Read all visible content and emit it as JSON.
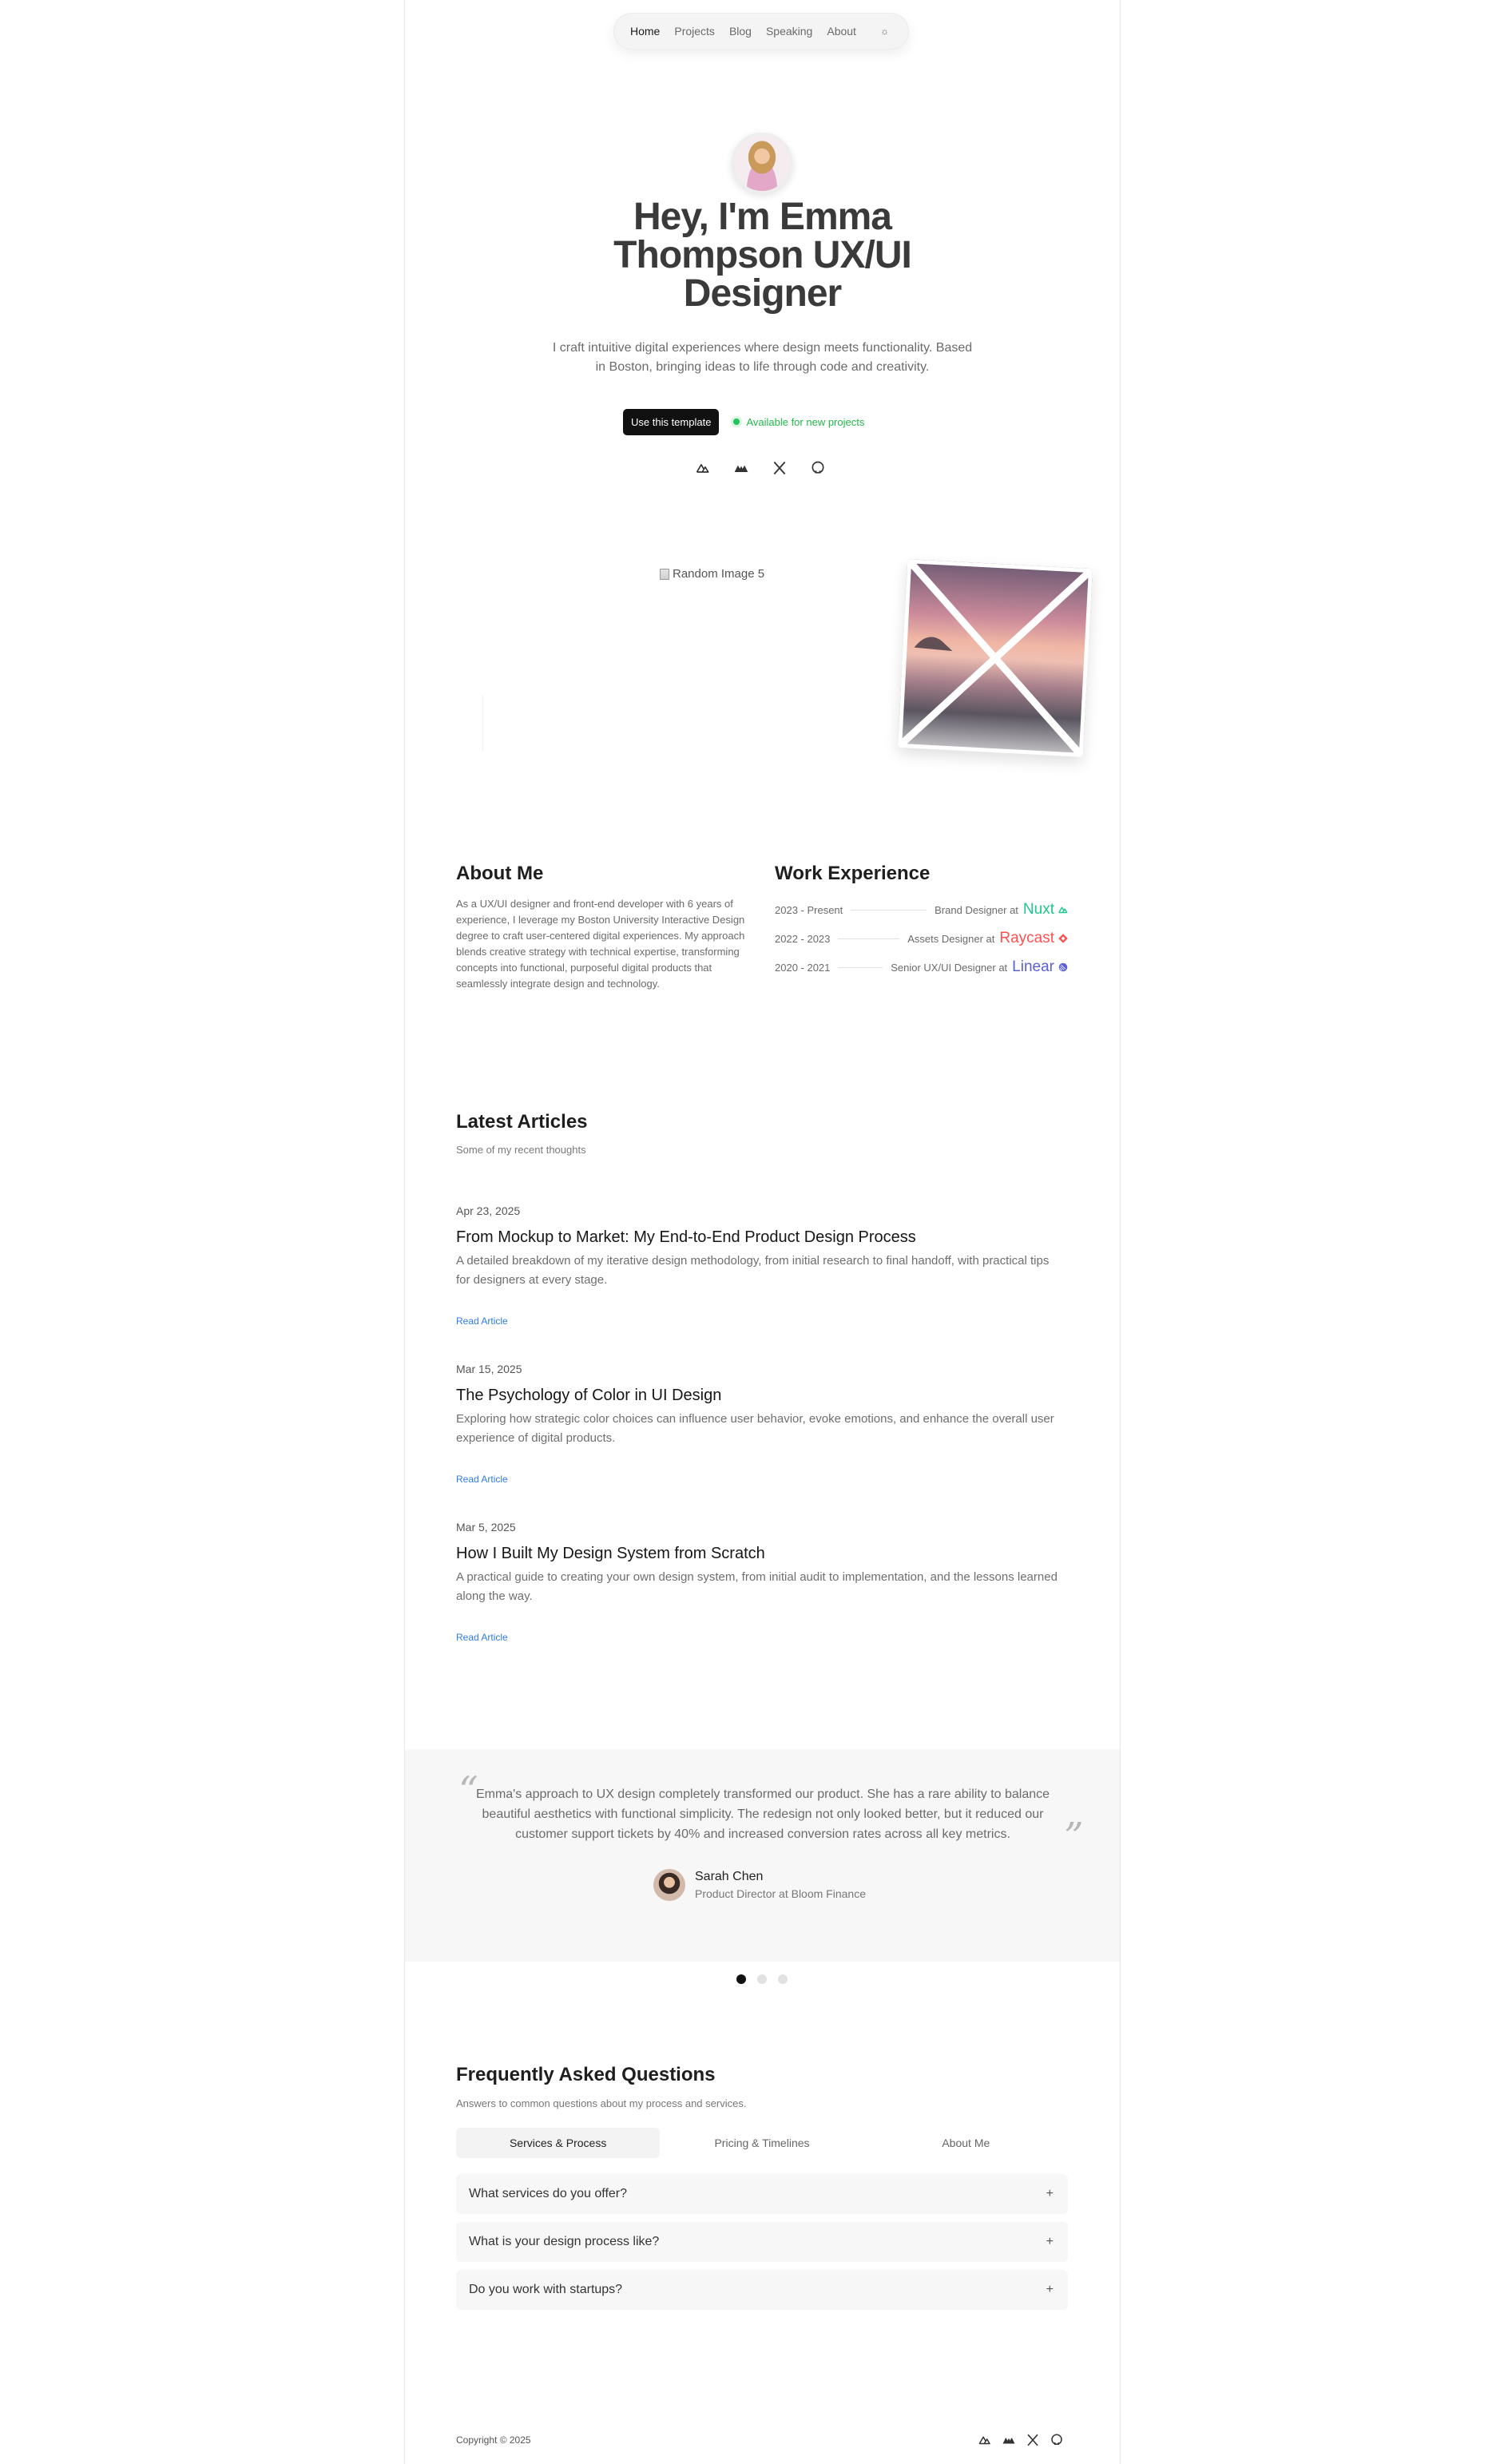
{
  "nav": {
    "items": [
      {
        "label": "Home",
        "active": true
      },
      {
        "label": "Projects",
        "active": false
      },
      {
        "label": "Blog",
        "active": false
      },
      {
        "label": "Speaking",
        "active": false
      },
      {
        "label": "About",
        "active": false
      }
    ],
    "theme_icon": "sun-icon"
  },
  "hero": {
    "title": "Hey, I'm Emma Thompson UX/UI Designer",
    "subtitle": "I craft intuitive digital experiences where design meets functionality. Based in Boston, bringing ideas to life through code and creativity.",
    "cta_label": "Use this template",
    "availability": "Available for new projects",
    "social_icons": [
      "nuxt-icon",
      "ghost-icon",
      "x-icon",
      "github-icon"
    ]
  },
  "gallery": {
    "broken_image_alt": "Random Image 5"
  },
  "about": {
    "title": "About Me",
    "text": "As a UX/UI designer and front-end developer with 6 years of experience, I leverage my Boston University Interactive Design degree to craft user-centered digital experiences. My approach blends creative strategy with technical expertise, transforming concepts into functional, purposeful digital products that seamlessly integrate design and technology."
  },
  "work": {
    "title": "Work Experience",
    "items": [
      {
        "period": "2023 - Present",
        "role": "Brand Designer at",
        "company": "Nuxt",
        "color": "#1ec88a"
      },
      {
        "period": "2022 - 2023",
        "role": "Assets Designer at",
        "company": "Raycast",
        "color": "#ff4f4f"
      },
      {
        "period": "2020 - 2021",
        "role": "Senior UX/UI Designer at",
        "company": "Linear",
        "color": "#5a5fd6"
      }
    ]
  },
  "articles": {
    "title": "Latest Articles",
    "subtitle": "Some of my recent thoughts",
    "items": [
      {
        "date": "Apr 23, 2025",
        "title": "From Mockup to Market: My End-to-End Product Design Process",
        "desc": "A detailed breakdown of my iterative design methodology, from initial research to final handoff, with practical tips for designers at every stage.",
        "link": "Read Article"
      },
      {
        "date": "Mar 15, 2025",
        "title": "The Psychology of Color in UI Design",
        "desc": "Exploring how strategic color choices can influence user behavior, evoke emotions, and enhance the overall user experience of digital products.",
        "link": "Read Article"
      },
      {
        "date": "Mar 5, 2025",
        "title": "How I Built My Design System from Scratch",
        "desc": "A practical guide to creating your own design system, from initial audit to implementation, and the lessons learned along the way.",
        "link": "Read Article"
      }
    ]
  },
  "testimonial": {
    "open_quote": "“",
    "close_quote": "”",
    "text": "Emma's approach to UX design completely transformed our product. She has a rare ability to balance beautiful aesthetics with functional simplicity. The redesign not only looked better, but it reduced our customer support tickets by 40% and increased conversion rates across all key metrics.",
    "name": "Sarah Chen",
    "role": "Product Director at Bloom Finance",
    "slide_count": 3,
    "active_slide": 1
  },
  "faq": {
    "title": "Frequently Asked Questions",
    "subtitle": "Answers to common questions about my process and services.",
    "tabs": [
      {
        "label": "Services & Process",
        "active": true
      },
      {
        "label": "Pricing & Timelines",
        "active": false
      },
      {
        "label": "About Me",
        "active": false
      }
    ],
    "items": [
      {
        "q": "What services do you offer?",
        "icon": "+"
      },
      {
        "q": "What is your design process like?",
        "icon": "+"
      },
      {
        "q": "Do you work with startups?",
        "icon": "+"
      }
    ]
  },
  "footer": {
    "copyright": "Copyright © 2025",
    "social_icons": [
      "nuxt-icon",
      "ghost-icon",
      "x-icon",
      "github-icon"
    ]
  }
}
